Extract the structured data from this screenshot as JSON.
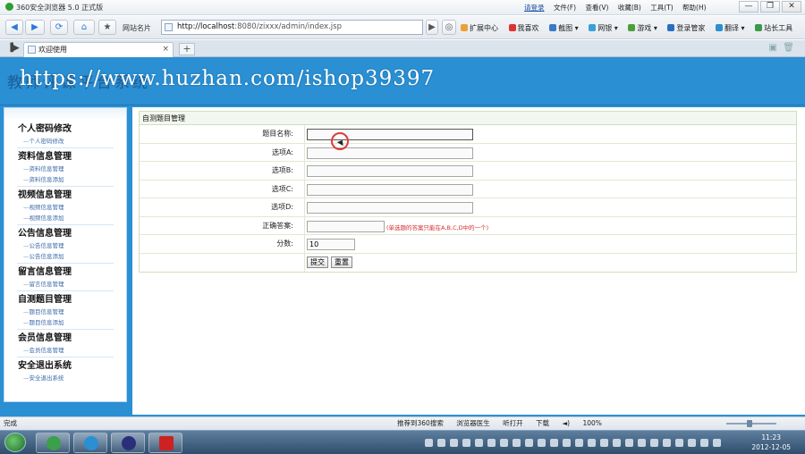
{
  "browser": {
    "app_title": "360安全浏览器 5.0 正式版",
    "menu": {
      "login": "请登录",
      "file": "文件(F)",
      "view": "查看(V)",
      "favorites": "收藏(B)",
      "tools": "工具(T)",
      "help": "帮助(H)"
    },
    "window_buttons": [
      "—",
      "❐",
      "✕"
    ],
    "nav": {
      "favorites_label": "网站名片",
      "address_host": "http://localhost",
      "address_rest": ":8080/zixxx/admin/index.jsp",
      "tools": [
        "扩展中心",
        "我喜欢",
        "截图",
        "网银",
        "游戏",
        "登录管家",
        "翻译",
        "站长工具"
      ]
    },
    "tab": {
      "label": "欢迎使用",
      "close": "×",
      "new": "+"
    },
    "status": {
      "left": "完成",
      "items": [
        "推荐到360搜索",
        "浏览器医生",
        "听打开",
        "下载"
      ],
      "zoom": "100%"
    }
  },
  "page": {
    "title": "教师评课平台系统",
    "watermark": "https://www.huzhan.com/ishop39397"
  },
  "sidebar": {
    "groups": [
      {
        "head": "个人密码修改",
        "items": [
          "个人密码修改"
        ]
      },
      {
        "head": "资料信息管理",
        "items": [
          "资料信息管理",
          "资料信息添加"
        ]
      },
      {
        "head": "视频信息管理",
        "items": [
          "视频信息管理",
          "视频信息添加"
        ]
      },
      {
        "head": "公告信息管理",
        "items": [
          "公告信息管理",
          "公告信息添加"
        ]
      },
      {
        "head": "留言信息管理",
        "items": [
          "留言信息管理"
        ]
      },
      {
        "head": "自测题目管理",
        "items": [
          "题目信息管理",
          "题目信息添加"
        ]
      },
      {
        "head": "会员信息管理",
        "items": [
          "会员信息管理"
        ]
      },
      {
        "head": "安全退出系统",
        "items": [
          "安全退出系统"
        ]
      }
    ]
  },
  "form": {
    "panel_title": "自测题目管理",
    "fields": {
      "name": {
        "label": "题目名称:",
        "value": ""
      },
      "a": {
        "label": "选项A:",
        "value": ""
      },
      "b": {
        "label": "选项B:",
        "value": ""
      },
      "c": {
        "label": "选项C:",
        "value": ""
      },
      "d": {
        "label": "选项D:",
        "value": ""
      },
      "answer": {
        "label": "正确答案:",
        "value": "",
        "hint": "(单选题的答案只能在A,B,C,D中的一个)"
      },
      "score": {
        "label": "分数:",
        "value": "10"
      }
    },
    "submit_label": "提交",
    "reset_label": "重置"
  },
  "taskbar": {
    "time": "11:23",
    "date": "2012-12-05"
  }
}
